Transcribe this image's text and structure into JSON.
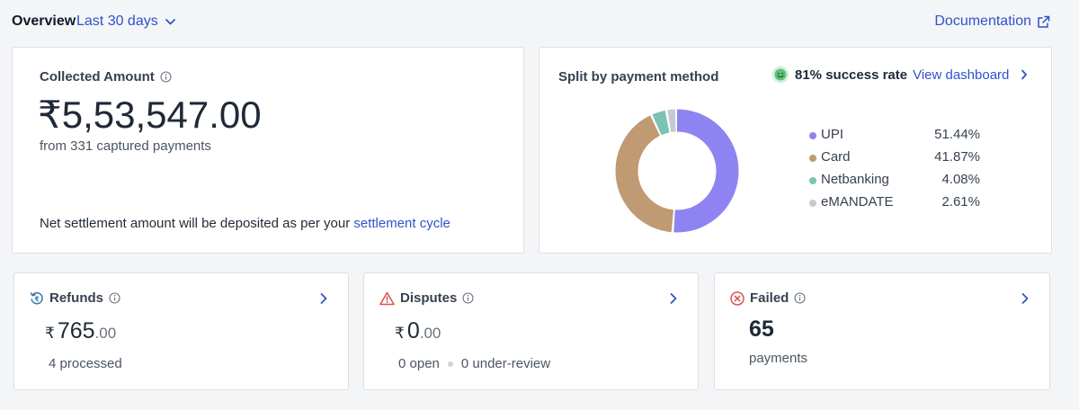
{
  "header": {
    "overview_label": "Overview",
    "range_label": "Last 30 days",
    "documentation_label": "Documentation"
  },
  "collected": {
    "title": "Collected Amount",
    "amount": "₹5,53,547.00",
    "subtitle": "from 331 captured payments",
    "settlement_text": "Net settlement amount will be deposited as per your",
    "settlement_link": "settlement cycle"
  },
  "split": {
    "title": "Split by payment method",
    "success_rate": "81% success rate",
    "view_dashboard": "View dashboard",
    "methods": [
      {
        "name": "UPI",
        "percent": "51.44%",
        "value": 51.44,
        "color": "#8f83f2"
      },
      {
        "name": "Card",
        "percent": "41.87%",
        "value": 41.87,
        "color": "#c09a72"
      },
      {
        "name": "Netbanking",
        "percent": "4.08%",
        "value": 4.08,
        "color": "#7cc3b3"
      },
      {
        "name": "eMANDATE",
        "percent": "2.61%",
        "value": 2.61,
        "color": "#c5cbd3"
      }
    ]
  },
  "refunds": {
    "title": "Refunds",
    "currency": "₹",
    "amount_int": "765",
    "amount_dec": ".00",
    "subtitle": "4 processed"
  },
  "disputes": {
    "title": "Disputes",
    "currency": "₹",
    "amount_int": "0",
    "amount_dec": ".00",
    "open": "0 open",
    "under_review": "0 under-review"
  },
  "failed": {
    "title": "Failed",
    "count": "65",
    "subtitle": "payments"
  },
  "colors": {
    "link": "#3252c9",
    "dispute_icon": "#d9534f",
    "failed_icon": "#d9534f",
    "refund_icon": "#3a7ca5",
    "success_face": "#5fbf7a"
  }
}
